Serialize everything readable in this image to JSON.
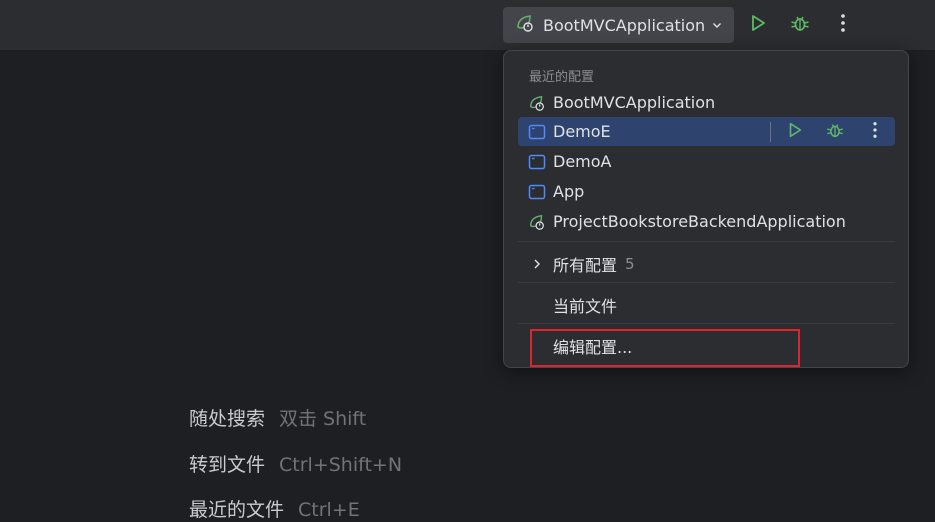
{
  "toolbar": {
    "run_config": "BootMVCApplication",
    "icons": [
      "spring-boot-icon",
      "chevron-down-icon",
      "run-icon",
      "debug-icon",
      "more-vertical-icon"
    ],
    "colors": {
      "run": "#5fb865",
      "spring": "#6aab73"
    }
  },
  "popup": {
    "recent_header": "最近的配置",
    "items": [
      {
        "label": "BootMVCApplication",
        "icon": "spring-boot-icon"
      },
      {
        "label": "DemoE",
        "icon": "application-icon",
        "selected": true
      },
      {
        "label": "DemoA",
        "icon": "application-icon"
      },
      {
        "label": "App",
        "icon": "application-icon"
      },
      {
        "label": "ProjectBookstoreBackendApplication",
        "icon": "spring-boot-icon"
      }
    ],
    "all_configs": {
      "label": "所有配置",
      "count": "5"
    },
    "current_file": "当前文件",
    "edit_configs": "编辑配置...",
    "colors": {
      "selection": "#2e436e",
      "highlight_box": "#e0242b",
      "app_icon": "#548af7"
    }
  },
  "hints": [
    {
      "name": "随处搜索",
      "key": "双击 Shift"
    },
    {
      "name": "转到文件",
      "key": "Ctrl+Shift+N"
    },
    {
      "name": "最近的文件",
      "key": "Ctrl+E"
    }
  ]
}
